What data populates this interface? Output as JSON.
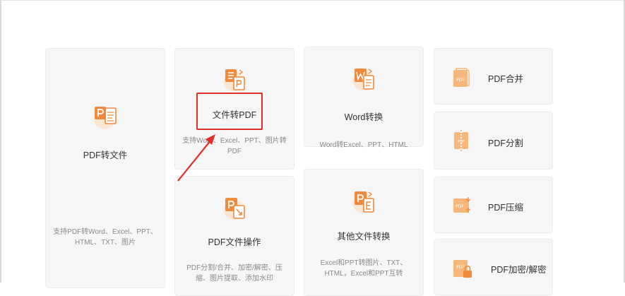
{
  "cards": {
    "pdf_to_file": {
      "title": "PDF转文件",
      "desc": "支持PDF转Word、Excel、PPT、HTML、TXT、图片",
      "icon": "pdf-convert-icon"
    },
    "file_to_pdf": {
      "title": "文件转PDF",
      "desc": "支持Word、Excel、PPT、图片转PDF",
      "icon": "file-to-pdf-icon"
    },
    "pdf_operations": {
      "title": "PDF文件操作",
      "desc": "PDF分割/合并、加密/解密、压缩、图片提取、添加水印",
      "icon": "pdf-operation-icon"
    },
    "word_convert": {
      "title": "Word转换",
      "desc": "Word转Excel、PPT、HTML",
      "icon": "word-convert-icon"
    },
    "other_convert": {
      "title": "其他文件转换",
      "desc": "Excel和PPT转图片、TXT、HTML，Excel和PPT互转",
      "icon": "other-convert-icon"
    }
  },
  "tools": [
    {
      "title": "PDF合并",
      "icon": "pdf-merge-icon"
    },
    {
      "title": "PDF分割",
      "icon": "pdf-split-icon"
    },
    {
      "title": "PDF压缩",
      "icon": "pdf-compress-icon"
    },
    {
      "title": "PDF加密/解密",
      "icon": "pdf-lock-icon"
    }
  ],
  "colors": {
    "accent": "#f08a3c",
    "highlight": "#e0302a",
    "card": "#f6f6f6"
  }
}
